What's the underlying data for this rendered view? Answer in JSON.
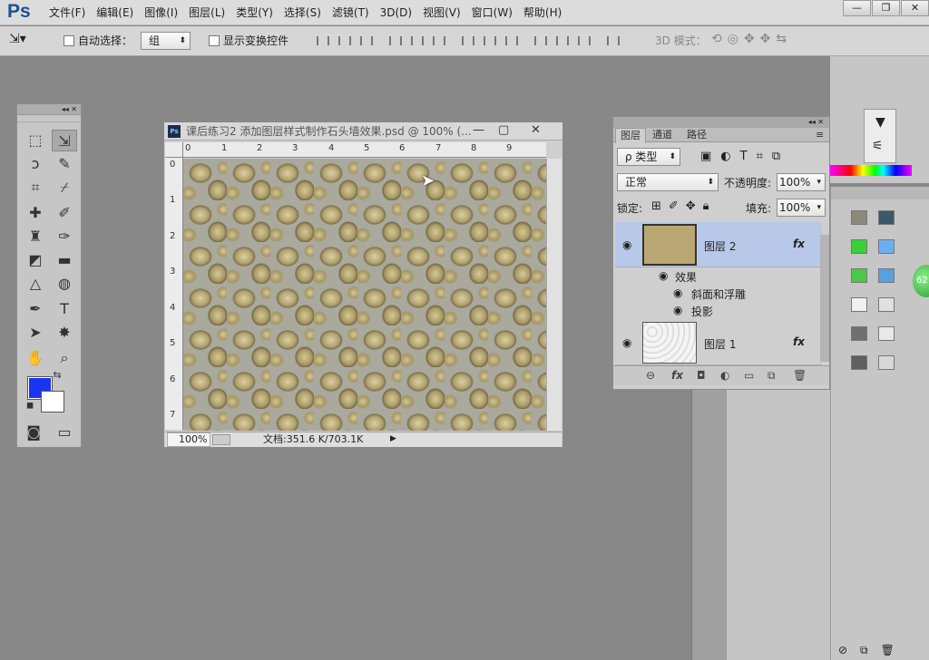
{
  "app": {
    "logo": "Ps"
  },
  "menu": [
    "文件(F)",
    "编辑(E)",
    "图像(I)",
    "图层(L)",
    "类型(Y)",
    "选择(S)",
    "滤镜(T)",
    "3D(D)",
    "视图(V)",
    "窗口(W)",
    "帮助(H)"
  ],
  "options": {
    "auto_select_label": "自动选择：",
    "auto_select_value": "组",
    "show_transform_label": "显示变换控件",
    "mode_3d_label": "3D 模式："
  },
  "document": {
    "title": "课后练习2 添加图层样式制作石头墙效果.psd @ 100% (...",
    "ruler_h": [
      "0",
      "1",
      "2",
      "3",
      "4",
      "5",
      "6",
      "7",
      "8",
      "9"
    ],
    "ruler_v": [
      "0",
      "1",
      "2",
      "3",
      "4",
      "5",
      "6",
      "7"
    ],
    "zoom": "100%",
    "doc_info": "文档:351.6 K/703.1K"
  },
  "layers_panel": {
    "tabs": [
      "图层",
      "通道",
      "路径"
    ],
    "filter_label": "ρ 类型",
    "blend_mode": "正常",
    "opacity_label": "不透明度:",
    "opacity_value": "100%",
    "lock_label": "锁定:",
    "fill_label": "填充:",
    "fill_value": "100%",
    "layers": [
      {
        "name": "图层 2",
        "fx": "fx",
        "selected": true
      },
      {
        "name": "图层 1",
        "fx": "fx",
        "selected": false
      }
    ],
    "effects_label": "效果",
    "effects": [
      "斜面和浮雕",
      "投影"
    ]
  },
  "side": {
    "badge": "62"
  },
  "colors": {
    "foreground": "#1a35f0",
    "background": "#ffffff",
    "selection": "#b8c8e8"
  }
}
